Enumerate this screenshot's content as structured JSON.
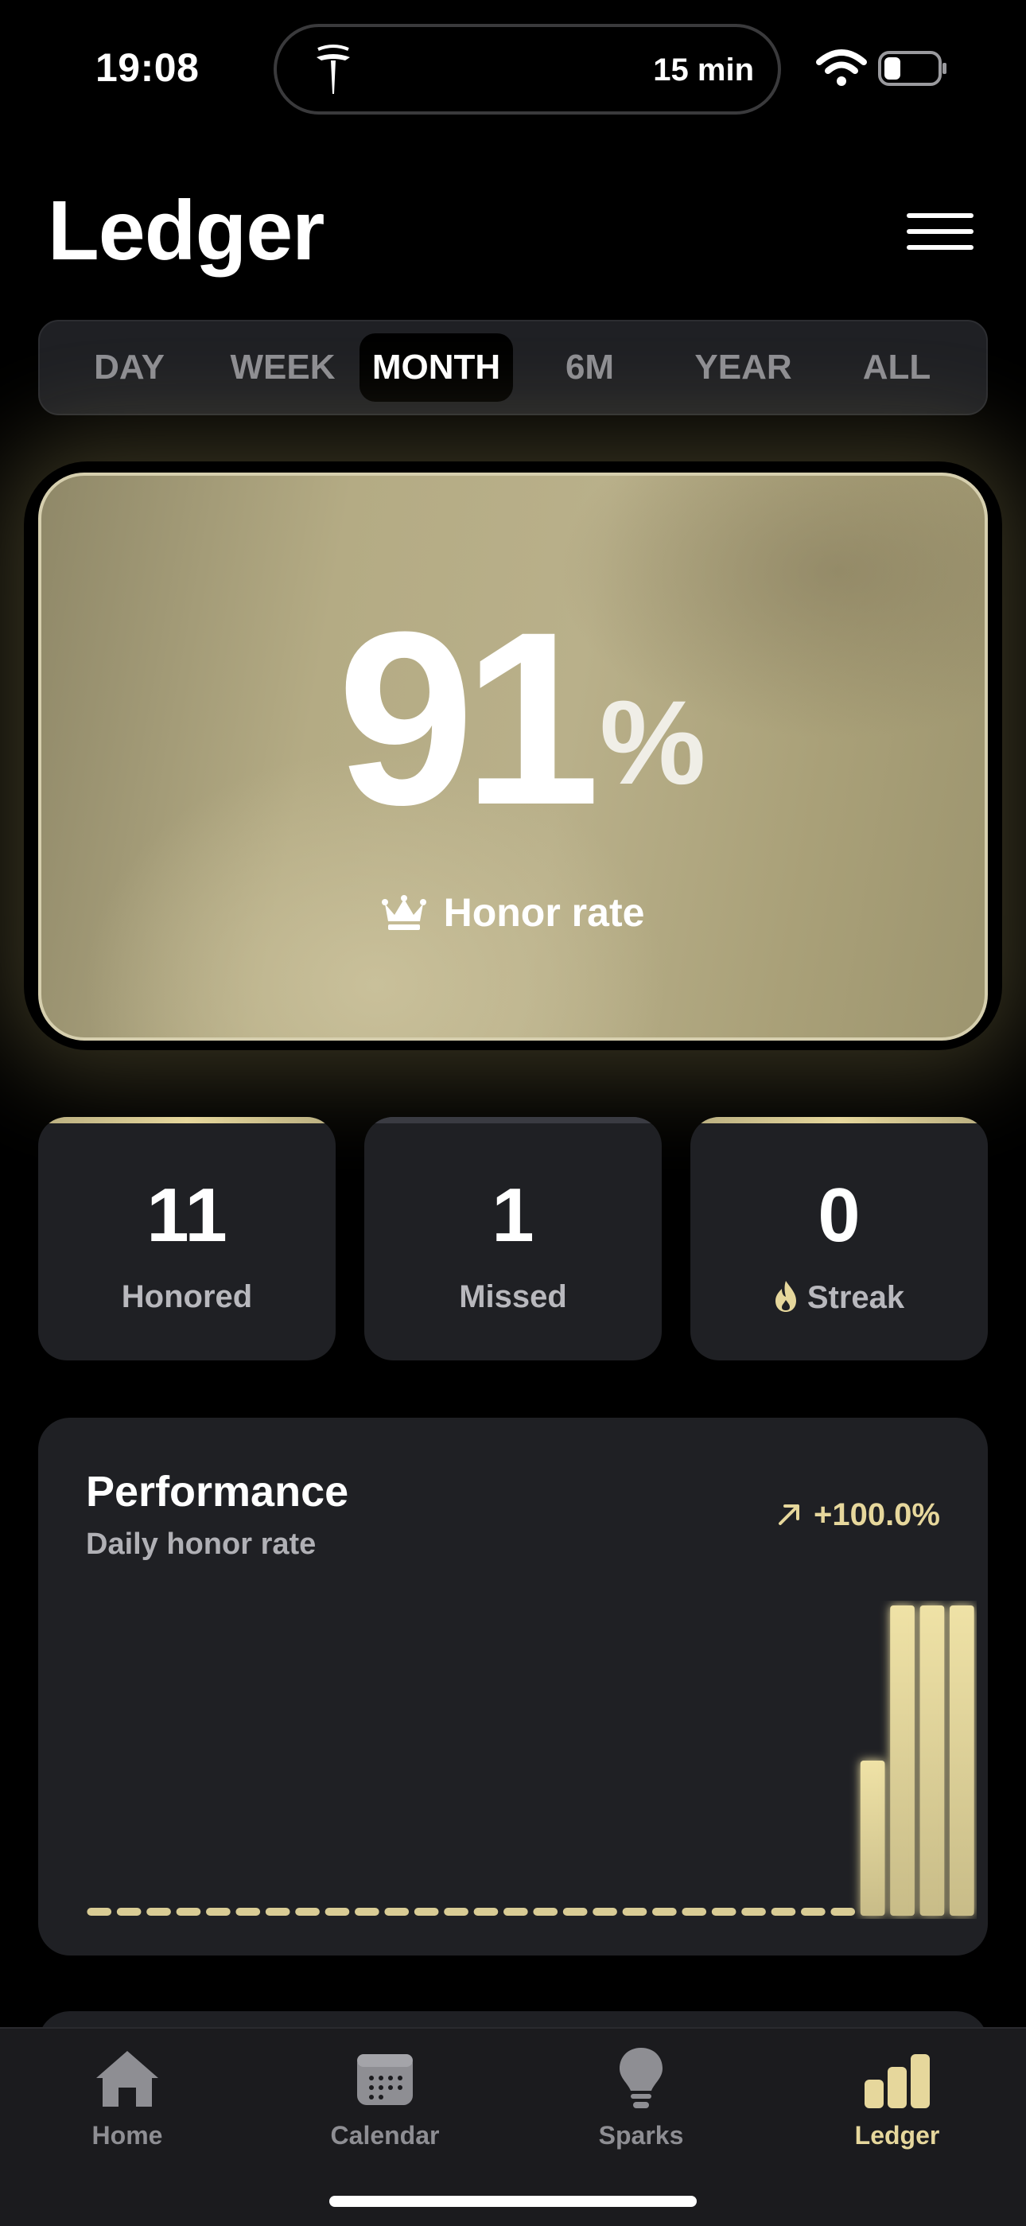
{
  "status_bar": {
    "time": "19:08",
    "island_timer": "15 min",
    "icons": [
      "tesla-logo-icon",
      "wifi-icon",
      "battery-icon"
    ]
  },
  "header": {
    "title": "Ledger",
    "menu_icon": "hamburger-menu-icon"
  },
  "period_tabs": {
    "items": [
      "DAY",
      "WEEK",
      "MONTH",
      "6M",
      "YEAR",
      "ALL"
    ],
    "selected": "MONTH"
  },
  "hero": {
    "value": "91",
    "unit": "%",
    "label": "Honor rate",
    "icon": "crown-icon"
  },
  "stats": [
    {
      "value": "11",
      "label": "Honored"
    },
    {
      "value": "1",
      "label": "Missed"
    },
    {
      "value": "0",
      "label": "Streak",
      "icon": "flame-icon"
    }
  ],
  "performance": {
    "title": "Performance",
    "subtitle": "Daily honor rate",
    "change": "+100.0%",
    "change_icon": "arrow-up-right-icon"
  },
  "chart_data": {
    "type": "bar",
    "title": "Performance",
    "subtitle": "Daily honor rate",
    "xlabel": "",
    "ylabel": "",
    "ylim": [
      0,
      100
    ],
    "grid": false,
    "values": [
      0,
      0,
      0,
      0,
      0,
      0,
      0,
      0,
      0,
      0,
      0,
      0,
      0,
      0,
      0,
      0,
      0,
      0,
      0,
      0,
      0,
      0,
      0,
      0,
      0,
      0,
      50,
      100,
      100,
      100
    ]
  },
  "tab_bar": {
    "items": [
      {
        "label": "Home",
        "icon": "house-icon"
      },
      {
        "label": "Calendar",
        "icon": "calendar-icon"
      },
      {
        "label": "Sparks",
        "icon": "lightbulb-icon"
      },
      {
        "label": "Ledger",
        "icon": "bar-chart-icon"
      }
    ],
    "active": "Ledger"
  },
  "colors": {
    "background": "#000000",
    "card": "#1f2024",
    "accent_gold": "#e6d79c",
    "hero_gold": "#b4ab84",
    "inactive": "#8e8e93"
  }
}
